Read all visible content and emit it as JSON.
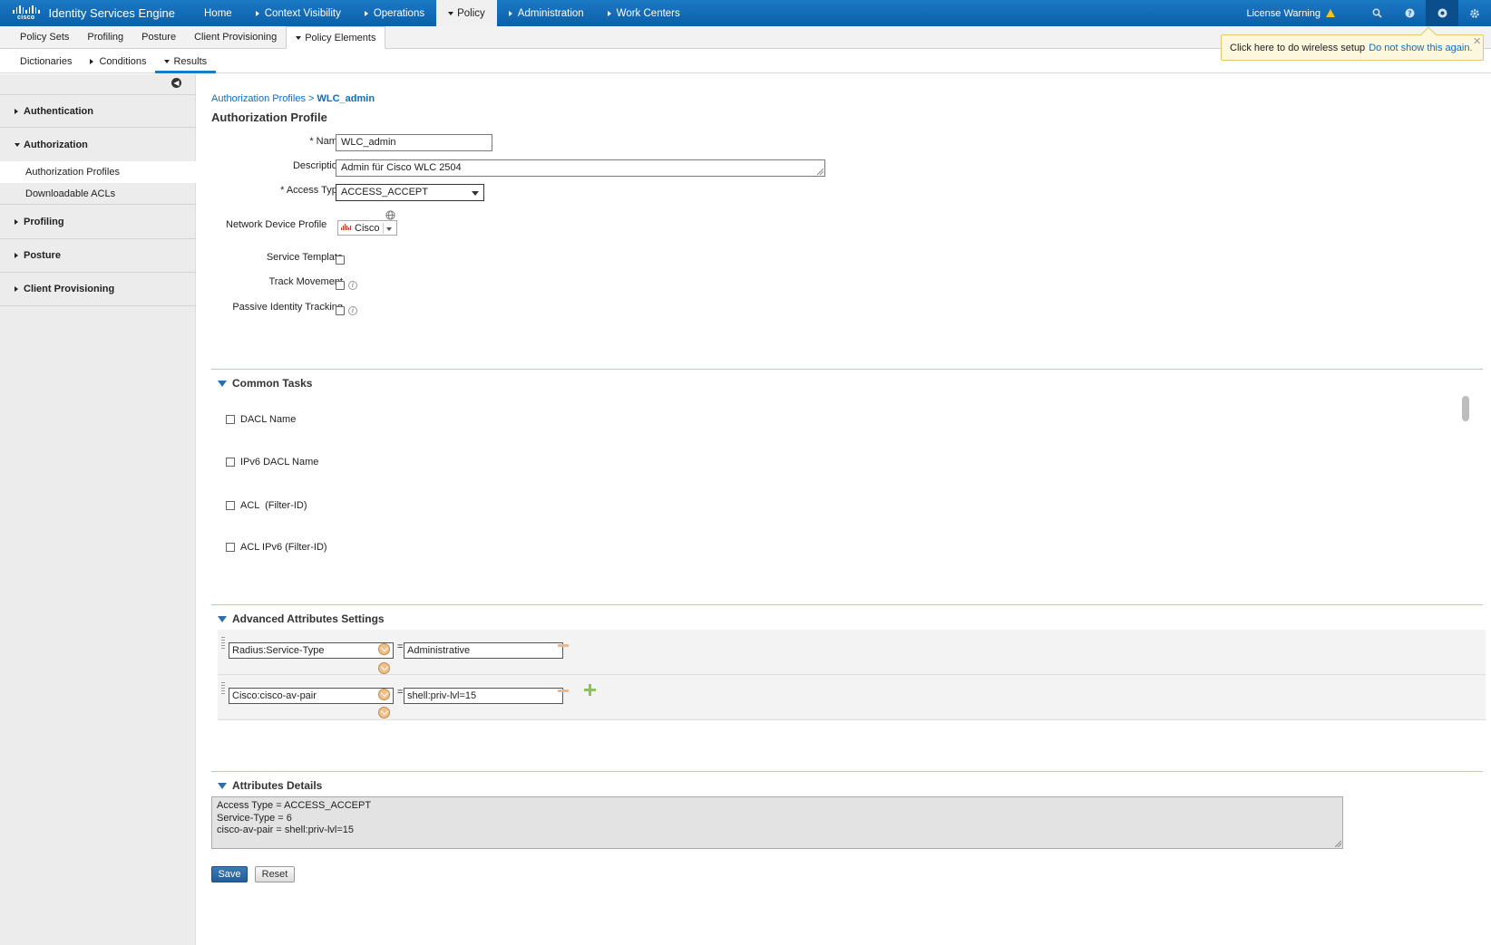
{
  "app": {
    "brand": "cisco",
    "title": "Identity Services Engine"
  },
  "topnav": {
    "items": [
      {
        "label": "Home"
      },
      {
        "label": "Context Visibility"
      },
      {
        "label": "Operations"
      },
      {
        "label": "Policy"
      },
      {
        "label": "Administration"
      },
      {
        "label": "Work Centers"
      }
    ],
    "license_warning": "License Warning"
  },
  "subnav1": {
    "items": [
      "Policy Sets",
      "Profiling",
      "Posture",
      "Client Provisioning",
      "Policy Elements"
    ]
  },
  "subnav2": {
    "items": [
      "Dictionaries",
      "Conditions",
      "Results"
    ]
  },
  "wireless_popup": {
    "text": "Click here to do wireless setup",
    "link": "Do not show this again."
  },
  "sidebar": {
    "sections": [
      "Authentication",
      "Authorization",
      "Profiling",
      "Posture",
      "Client Provisioning"
    ],
    "authorization_items": [
      "Authorization Profiles",
      "Downloadable ACLs"
    ]
  },
  "breadcrumb": {
    "parent": "Authorization Profiles",
    "sep": ">",
    "current": "WLC_admin"
  },
  "page_title": "Authorization Profile",
  "form": {
    "name_label": "* Name",
    "name_value": "WLC_admin",
    "description_label": "Description",
    "description_value": "Admin für Cisco WLC 2504",
    "access_type_label": "* Access Type",
    "access_type_value": "ACCESS_ACCEPT",
    "ndp_label": "Network Device Profile",
    "ndp_value": "Cisco",
    "service_template_label": "Service Template",
    "track_movement_label": "Track Movement",
    "passive_identity_label": "Passive Identity Tracking"
  },
  "common_tasks": {
    "title": "Common Tasks",
    "items": [
      "DACL Name",
      "IPv6 DACL Name",
      "ACL  (Filter-ID)",
      "ACL IPv6 (Filter-ID)"
    ]
  },
  "advanced": {
    "title": "Advanced Attributes Settings",
    "rows": [
      {
        "attribute": "Radius:Service-Type",
        "op": "=",
        "value": "Administrative"
      },
      {
        "attribute": "Cisco:cisco-av-pair",
        "op": "=",
        "value": "shell:priv-lvl=15"
      }
    ]
  },
  "attributes_details": {
    "title": "Attributes Details",
    "lines": [
      "Access Type = ACCESS_ACCEPT",
      "Service-Type = 6",
      "cisco-av-pair = shell:priv-lvl=15"
    ]
  },
  "buttons": {
    "save": "Save",
    "reset": "Reset"
  },
  "colors": {
    "topbar": "#1b78c4",
    "link": "#0b6fc2",
    "section_line": "#a9cde8",
    "save_button": "#2d6fa7"
  }
}
